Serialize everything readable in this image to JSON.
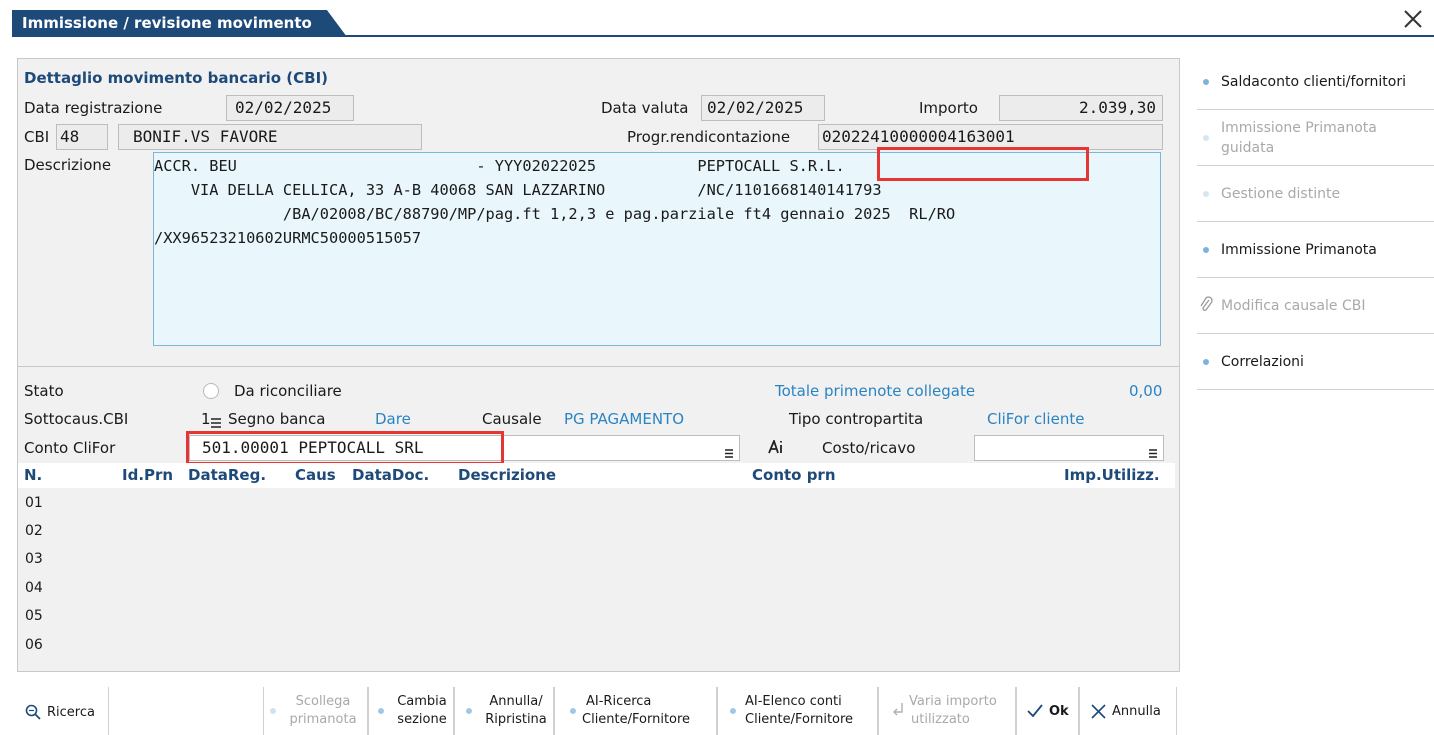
{
  "window": {
    "title": "Immissione / revisione movimento"
  },
  "detail": {
    "section_title": "Dettaglio movimento bancario (CBI)",
    "data_registrazione_label": "Data registrazione",
    "data_registrazione": "02/02/2025",
    "data_valuta_label": "Data valuta",
    "data_valuta": "02/02/2025",
    "importo_label": "Importo",
    "importo": "2.039,30",
    "cbi_label": "CBI",
    "cbi_code": "48",
    "cbi_desc": "BONIF.VS FAVORE",
    "progr_label": "Progr.rendicontazione",
    "progr_value": "02022410000004163001",
    "descrizione_label": "Descrizione",
    "descrizione_lines": [
      "ACCR. BEU                          - YYY02022025           PEPTOCALL S.R.L.",
      "    VIA DELLA CELLICA, 33 A-B 40068 SAN LAZZARINO          /NC/1101668140141793",
      "              /BA/02008/BC/88790/MP/pag.ft 1,2,3 e pag.parziale ft4 gennaio 2025  RL/RO",
      "/XX96523210602URMC50000515057"
    ]
  },
  "status": {
    "stato_label": "Stato",
    "stato_value": "Da riconciliare",
    "totale_label": "Totale primenote collegate",
    "totale_value": "0,00",
    "sottocaus_label": "Sottocaus.CBI",
    "sottocaus_value": "1",
    "segno_label": "Segno banca",
    "segno_value": "Dare",
    "causale_label": "Causale",
    "causale_value": "PG PAGAMENTO",
    "tipo_label": "Tipo contropartita",
    "tipo_value": "CliFor cliente",
    "conto_label": "Conto CliFor",
    "conto_value": "501.00001 PEPTOCALL SRL",
    "costo_label": "Costo/ricavo",
    "costo_value": ""
  },
  "table": {
    "columns": [
      "N.",
      "Id.Prn",
      "DataReg.",
      "Caus",
      "DataDoc.",
      "Descrizione",
      "Conto prn",
      "Imp.Utilizz."
    ],
    "rows": [
      "01",
      "02",
      "03",
      "04",
      "05",
      "06"
    ]
  },
  "sidebar": {
    "items": [
      {
        "label": "Saldaconto clienti/fornitori",
        "enabled": true
      },
      {
        "label": "Immissione Primanota guidata",
        "enabled": false
      },
      {
        "label": "Gestione distinte",
        "enabled": false
      },
      {
        "label": "Immissione Primanota",
        "enabled": true
      },
      {
        "label": "Modifica causale CBI",
        "enabled": false
      },
      {
        "label": "Correlazioni",
        "enabled": true
      }
    ]
  },
  "toolbar": {
    "ricerca": "Ricerca",
    "scollega_1": "Scollega",
    "scollega_2": "primanota",
    "cambia_1": "Cambia",
    "cambia_2": "sezione",
    "annulla_rip_1": "Annulla/",
    "annulla_rip_2": "Ripristina",
    "ai_ricerca_1": "AI-Ricerca",
    "ai_ricerca_2": "Cliente/Fornitore",
    "ai_elenco_1": "AI-Elenco conti",
    "ai_elenco_2": "Cliente/Fornitore",
    "varia_1": "Varia importo",
    "varia_2": "utilizzato",
    "ok": "Ok",
    "annulla": "Annulla"
  },
  "colors": {
    "title_bg": "#1e4a7a",
    "accent_blue": "#2a84c4",
    "highlight_red": "#e53535",
    "description_bg": "#e9f6fc"
  }
}
